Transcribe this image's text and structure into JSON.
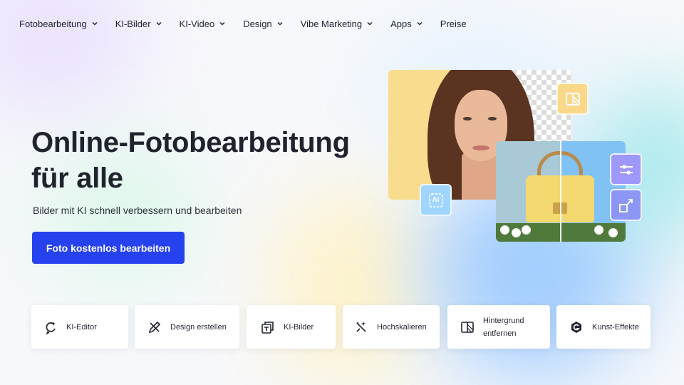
{
  "nav": {
    "items": [
      {
        "label": "Fotobearbeitung",
        "has_dropdown": true
      },
      {
        "label": "KI-Bilder",
        "has_dropdown": true
      },
      {
        "label": "KI-Video",
        "has_dropdown": true
      },
      {
        "label": "Design",
        "has_dropdown": true
      },
      {
        "label": "Vibe Marketing",
        "has_dropdown": true
      },
      {
        "label": "Apps",
        "has_dropdown": true
      },
      {
        "label": "Preise",
        "has_dropdown": false
      }
    ]
  },
  "hero": {
    "title_line1": "Online-Fotobearbeitung",
    "title_line2": "für alle",
    "subtitle": "Bilder mit KI schnell verbessern und bearbeiten",
    "cta_label": "Foto kostenlos bearbeiten",
    "cta_color": "#2642ee"
  },
  "badges": {
    "ai_label": "AI"
  },
  "features": [
    {
      "label": "KI-Editor",
      "icon": "ai-editor-icon"
    },
    {
      "label": "Design erstellen",
      "icon": "design-pencil-icon"
    },
    {
      "label": "KI-Bilder",
      "icon": "ai-images-icon"
    },
    {
      "label": "Hochskalieren",
      "icon": "upscale-sparkle-icon"
    },
    {
      "label": "Hintergrund entfernen",
      "icon": "background-remove-icon"
    },
    {
      "label": "Kunst-Effekte",
      "icon": "art-effects-icon"
    }
  ]
}
